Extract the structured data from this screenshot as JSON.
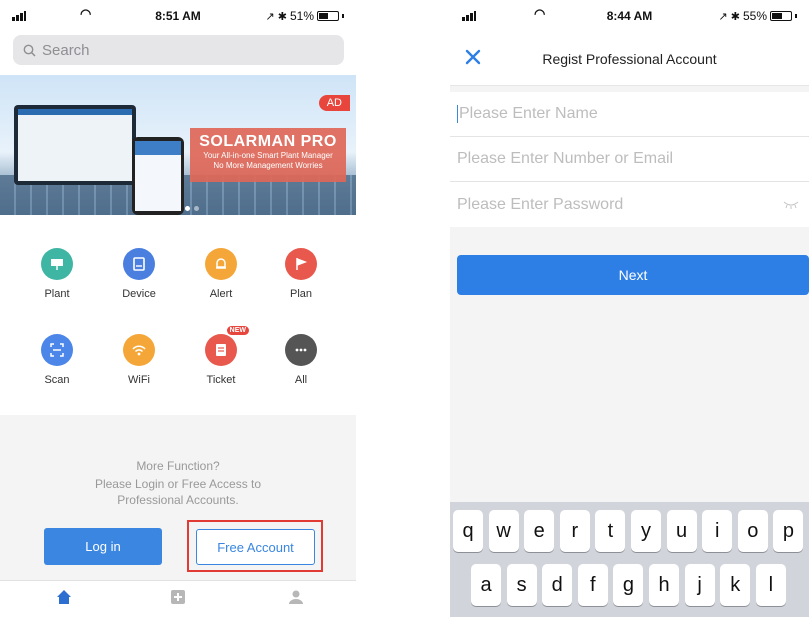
{
  "left_screen": {
    "status": {
      "time": "8:51 AM",
      "battery": "51%",
      "battery_level": 0.51
    },
    "search": {
      "placeholder": "Search"
    },
    "banner": {
      "ad_tag": "AD",
      "title": "SOLARMAN PRO",
      "subtitle_1": "Your All-in-one Smart Plant Manager",
      "subtitle_2": "No More Management Worries"
    },
    "functions": [
      {
        "label": "Plant",
        "icon": "solar-panel-icon",
        "color": "#3fb5a3"
      },
      {
        "label": "Device",
        "icon": "device-icon",
        "color": "#4a7fe0"
      },
      {
        "label": "Alert",
        "icon": "bell-icon",
        "color": "#f5a638"
      },
      {
        "label": "Plan",
        "icon": "flag-icon",
        "color": "#e8584c"
      },
      {
        "label": "Scan",
        "icon": "scan-icon",
        "color": "#4b86e8"
      },
      {
        "label": "WiFi",
        "icon": "wifi-icon",
        "color": "#f5a638"
      },
      {
        "label": "Ticket",
        "icon": "ticket-icon",
        "color": "#e8584c",
        "badge": "NEW"
      },
      {
        "label": "All",
        "icon": "more-icon",
        "color": "#555555"
      }
    ],
    "more": {
      "heading": "More Function?",
      "line_1": "Please Login or Free Access to",
      "line_2": "Professional Accounts."
    },
    "buttons": {
      "login": "Log in",
      "free_account": "Free Account"
    },
    "tabbar": {
      "active": "home-icon",
      "items": [
        "home-icon",
        "add-icon",
        "user-icon"
      ]
    }
  },
  "right_screen": {
    "status": {
      "time": "8:44 AM",
      "battery": "55%",
      "battery_level": 0.55
    },
    "title": "Regist Professional Account",
    "fields": {
      "name_placeholder": "Please Enter Name",
      "contact_placeholder": "Please Enter Number or Email",
      "password_placeholder": "Please Enter Password"
    },
    "next_button": "Next",
    "keyboard": {
      "row_1": [
        "q",
        "w",
        "e",
        "r",
        "t",
        "y",
        "u",
        "i",
        "o",
        "p"
      ],
      "row_2": [
        "a",
        "s",
        "d",
        "f",
        "g",
        "h",
        "j",
        "k",
        "l"
      ]
    }
  },
  "colors": {
    "primary": "#2d7fe6",
    "highlight": "#e23b35",
    "badge": "#e8453c"
  }
}
